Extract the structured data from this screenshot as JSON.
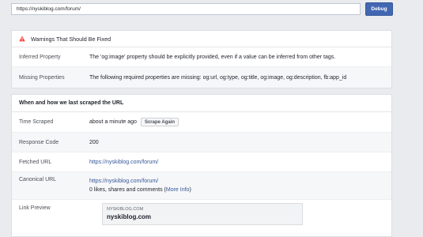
{
  "url_input": {
    "value": "https://nyskiblog.com/forum/"
  },
  "debug_button": {
    "label": "Debug"
  },
  "warnings": {
    "title": "Warnings That Should Be Fixed",
    "rows": [
      {
        "label": "Inferred Property",
        "value": "The 'og:image' property should be explicitly provided, even if a value can be inferred from other tags."
      },
      {
        "label": "Missing Properties",
        "value": "The following required properties are missing: og:url, og:type, og:title, og:image, og:description, fb:app_id"
      }
    ]
  },
  "scrape": {
    "title": "When and how we last scraped the URL",
    "time_scraped": {
      "label": "Time Scraped",
      "value": "about a minute ago",
      "button": "Scrape Again"
    },
    "response_code": {
      "label": "Response Code",
      "value": "200"
    },
    "fetched_url": {
      "label": "Fetched URL",
      "value": "https://nyskiblog.com/forum/"
    },
    "canonical_url": {
      "label": "Canonical URL",
      "value": "https://nyskiblog.com/forum/",
      "stats": "0 likes, shares and comments (",
      "more_info": "More Info",
      "stats_end": ")"
    },
    "link_preview": {
      "label": "Link Preview",
      "domain": "NYSKIBLOG.COM",
      "title": "nyskiblog.com"
    }
  },
  "colors": {
    "accent": "#4267b2",
    "link": "#365899",
    "warning": "#fa3e3e"
  }
}
